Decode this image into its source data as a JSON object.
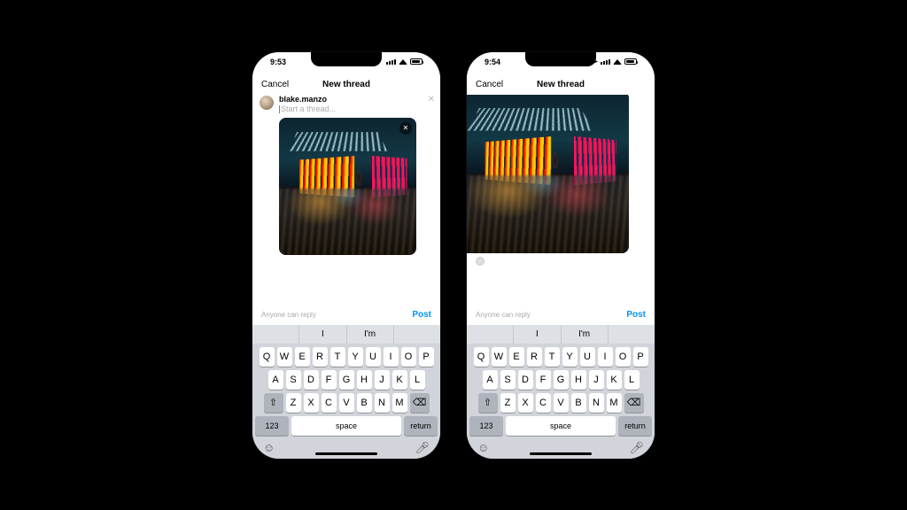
{
  "left": {
    "status": {
      "time": "9:53",
      "location_icon_visible": false
    },
    "nav": {
      "cancel": "Cancel",
      "title": "New thread"
    },
    "composer": {
      "username": "blake.manzo",
      "placeholder": "Start a thread...",
      "show_header": true,
      "show_image_close": true,
      "show_small_avatar": false
    },
    "footer": {
      "reply": "Anyone can reply",
      "post": "Post"
    }
  },
  "right": {
    "status": {
      "time": "9:54",
      "location_icon_visible": true
    },
    "nav": {
      "cancel": "Cancel",
      "title": "New thread"
    },
    "composer": {
      "username": "",
      "placeholder": "",
      "show_header": false,
      "show_image_close": false,
      "show_small_avatar": true
    },
    "footer": {
      "reply": "Anyone can reply",
      "post": "Post"
    }
  },
  "keyboard": {
    "suggestions": [
      "",
      "I",
      "I'm",
      ""
    ],
    "row1": [
      "Q",
      "W",
      "E",
      "R",
      "T",
      "Y",
      "U",
      "I",
      "O",
      "P"
    ],
    "row2": [
      "A",
      "S",
      "D",
      "F",
      "G",
      "H",
      "J",
      "K",
      "L"
    ],
    "row3": [
      "Z",
      "X",
      "C",
      "V",
      "B",
      "N",
      "M"
    ],
    "numbers_label": "123",
    "space_label": "space",
    "return_label": "return"
  }
}
